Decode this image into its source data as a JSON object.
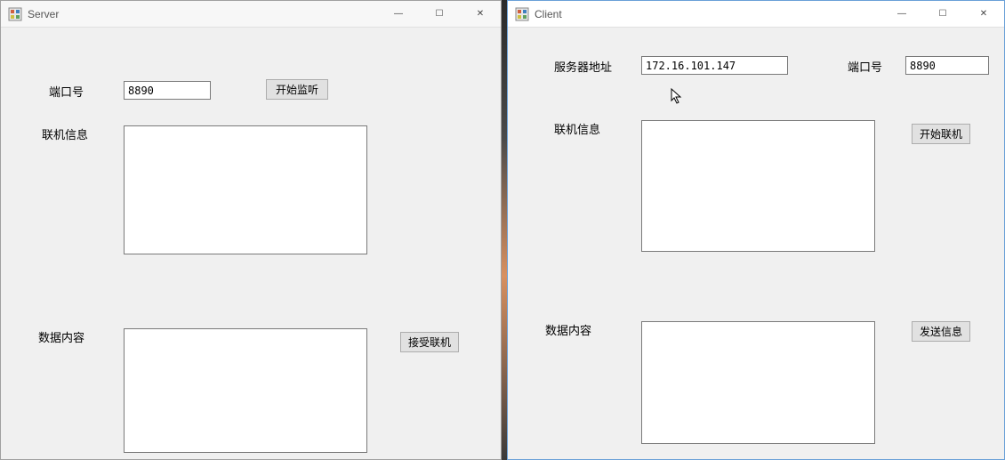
{
  "server": {
    "title": "Server",
    "port_label": "端口号",
    "port_value": "8890",
    "start_listen_label": "开始监听",
    "info_label": "联机信息",
    "info_value": "",
    "data_label": "数据内容",
    "data_value": "",
    "accept_label": "接受联机"
  },
  "client": {
    "title": "Client",
    "server_addr_label": "服务器地址",
    "server_addr_value": "172.16.101.147",
    "port_label": "端口号",
    "port_value": "8890",
    "info_label": "联机信息",
    "info_value": "",
    "start_connect_label": "开始联机",
    "data_label": "数据内容",
    "data_value": "",
    "send_label": "发送信息"
  },
  "window_controls": {
    "minimize": "—",
    "maximize": "☐",
    "close": "✕"
  }
}
